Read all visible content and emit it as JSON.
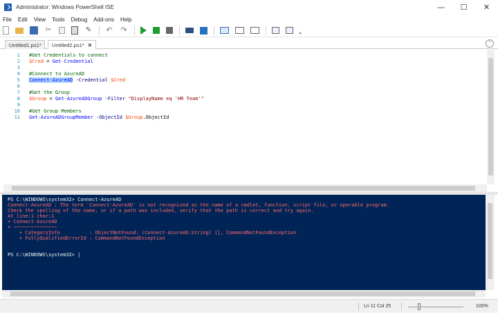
{
  "window": {
    "title": "Administrator: Windows PowerShell ISE",
    "minimize": "—",
    "maximize": "☐",
    "close": "✕"
  },
  "menu": [
    "File",
    "Edit",
    "View",
    "Tools",
    "Debug",
    "Add-ons",
    "Help"
  ],
  "tabs": [
    {
      "label": "Untitled1.ps1*"
    },
    {
      "label": "Untitled2.ps1*",
      "close": "✕"
    }
  ],
  "tabs_scroll": "⌃",
  "editor": {
    "lines": [
      {
        "n": "1",
        "parts": [
          {
            "t": "#Get Credentials to connect",
            "c": "comment"
          }
        ]
      },
      {
        "n": "2",
        "parts": [
          {
            "t": "$Cred",
            "c": "var"
          },
          {
            "t": " = ",
            "c": "plain"
          },
          {
            "t": "Get-Credential",
            "c": "cmd"
          }
        ]
      },
      {
        "n": "3",
        "parts": []
      },
      {
        "n": "4",
        "parts": [
          {
            "t": "#Connect to AzureAD",
            "c": "comment"
          }
        ]
      },
      {
        "n": "5",
        "parts": [
          {
            "t": "Connect-AzureAD",
            "c": "sel"
          },
          {
            "t": " ",
            "c": "plain"
          },
          {
            "t": "-Credential",
            "c": "param"
          },
          {
            "t": " ",
            "c": "plain"
          },
          {
            "t": "$Cred",
            "c": "var"
          }
        ]
      },
      {
        "n": "6",
        "parts": []
      },
      {
        "n": "7",
        "parts": [
          {
            "t": "#Get the Group",
            "c": "comment"
          }
        ]
      },
      {
        "n": "8",
        "parts": [
          {
            "t": "$Group",
            "c": "var"
          },
          {
            "t": " = ",
            "c": "plain"
          },
          {
            "t": "Get-AzureADGroup",
            "c": "cmd"
          },
          {
            "t": " ",
            "c": "plain"
          },
          {
            "t": "-Filter",
            "c": "param"
          },
          {
            "t": " ",
            "c": "plain"
          },
          {
            "t": "\"DisplayName eq 'HR Team'\"",
            "c": "str"
          }
        ]
      },
      {
        "n": "9",
        "parts": []
      },
      {
        "n": "10",
        "parts": [
          {
            "t": "#Get Group Members",
            "c": "comment"
          }
        ]
      },
      {
        "n": "11",
        "parts": [
          {
            "t": "Get-AzureADGroupMember",
            "c": "cmd"
          },
          {
            "t": " ",
            "c": "plain"
          },
          {
            "t": "-ObjectId",
            "c": "param"
          },
          {
            "t": " ",
            "c": "plain"
          },
          {
            "t": "$Group",
            "c": "var"
          },
          {
            "t": ".ObjectId",
            "c": "plain"
          }
        ]
      }
    ]
  },
  "console": {
    "lines": [
      {
        "t": "PS C:\\WINDOWS\\system32> Connect-AzureAD",
        "c": "prompt"
      },
      {
        "t": "Connect-AzureAD : The term 'Connect-AzureAD' is not recognized as the name of a cmdlet, function, script file, or operable program.",
        "c": "err"
      },
      {
        "t": "Check the spelling of the name, or if a path was included, verify that the path is correct and try again.",
        "c": "err"
      },
      {
        "t": "At line:1 char:1",
        "c": "err"
      },
      {
        "t": "+ Connect-AzureAD",
        "c": "err"
      },
      {
        "t": "+ ~~~~~~~~~~~~~~~",
        "c": "err"
      },
      {
        "t": "    + CategoryInfo          : ObjectNotFound: (Connect-AzureAD:String) [], CommandNotFoundException",
        "c": "err"
      },
      {
        "t": "    + FullyQualifiedErrorId : CommandNotFoundException",
        "c": "err"
      },
      {
        "t": "",
        "c": "prompt"
      },
      {
        "t": "",
        "c": "prompt"
      },
      {
        "t": "PS C:\\WINDOWS\\system32> |",
        "c": "prompt"
      }
    ]
  },
  "status": {
    "position": "Ln 11  Col 25",
    "zoom": "100%"
  }
}
